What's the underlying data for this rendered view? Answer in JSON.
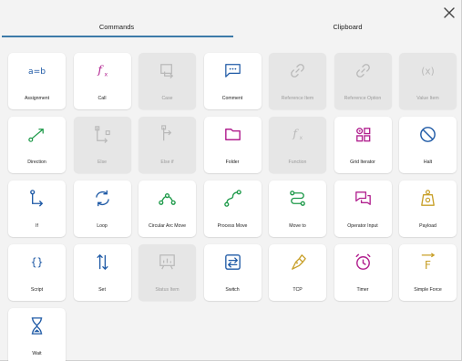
{
  "tabs": [
    {
      "label": "Commands",
      "active": true
    },
    {
      "label": "Clipboard",
      "active": false
    }
  ],
  "colors": {
    "tab_underline": "#3c7aa8",
    "blue": "#1f5aa6",
    "magenta": "#b1208f",
    "green": "#1e9a4a",
    "gold": "#c8a02a",
    "disabled": "#b9b9b9"
  },
  "commands": [
    {
      "label": "Assignment",
      "icon": "assignment-icon",
      "enabled": true
    },
    {
      "label": "Call",
      "icon": "function-icon",
      "enabled": true
    },
    {
      "label": "Case",
      "icon": "case-icon",
      "enabled": false
    },
    {
      "label": "Comment",
      "icon": "comment-icon",
      "enabled": true
    },
    {
      "label": "Reference Item",
      "icon": "link-icon",
      "enabled": false
    },
    {
      "label": "Reference Option",
      "icon": "link-icon",
      "enabled": false
    },
    {
      "label": "Value Item",
      "icon": "variable-icon",
      "enabled": false
    },
    {
      "label": "Direction",
      "icon": "direction-icon",
      "enabled": true
    },
    {
      "label": "Else",
      "icon": "else-icon",
      "enabled": false
    },
    {
      "label": "Else if",
      "icon": "else-if-icon",
      "enabled": false
    },
    {
      "label": "Folder",
      "icon": "folder-icon",
      "enabled": true
    },
    {
      "label": "Function",
      "icon": "function-icon",
      "enabled": false
    },
    {
      "label": "Grid Iterator",
      "icon": "grid-iterator-icon",
      "enabled": true
    },
    {
      "label": "Halt",
      "icon": "halt-icon",
      "enabled": true
    },
    {
      "label": "If",
      "icon": "if-icon",
      "enabled": true
    },
    {
      "label": "Loop",
      "icon": "loop-icon",
      "enabled": true
    },
    {
      "label": "Circular Arc Move",
      "icon": "arc-move-icon",
      "enabled": true
    },
    {
      "label": "Process Move",
      "icon": "process-move-icon",
      "enabled": true
    },
    {
      "label": "Move to",
      "icon": "move-to-icon",
      "enabled": true
    },
    {
      "label": "Operator Input",
      "icon": "operator-input-icon",
      "enabled": true
    },
    {
      "label": "Payload",
      "icon": "payload-icon",
      "enabled": true
    },
    {
      "label": "Script",
      "icon": "script-icon",
      "enabled": true
    },
    {
      "label": "Set",
      "icon": "set-icon",
      "enabled": true
    },
    {
      "label": "Status Item",
      "icon": "status-icon",
      "enabled": false
    },
    {
      "label": "Switch",
      "icon": "switch-icon",
      "enabled": true
    },
    {
      "label": "TCP",
      "icon": "tcp-icon",
      "enabled": true
    },
    {
      "label": "Timer",
      "icon": "timer-icon",
      "enabled": true
    },
    {
      "label": "Simple Force",
      "icon": "force-icon",
      "enabled": true
    },
    {
      "label": "Wait",
      "icon": "hourglass-icon",
      "enabled": true
    }
  ]
}
